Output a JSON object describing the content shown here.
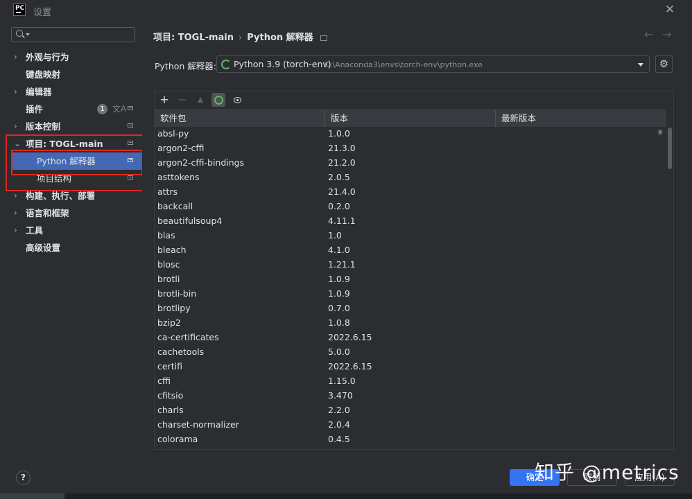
{
  "window": {
    "title": "设置",
    "logo_text": "PC"
  },
  "sidebar": {
    "search_placeholder": "",
    "items": [
      {
        "label": "外观与行为",
        "chevron": "›"
      },
      {
        "label": "键盘映射"
      },
      {
        "label": "编辑器",
        "chevron": "›"
      },
      {
        "label": "插件",
        "badge": "1",
        "translate": "文A"
      },
      {
        "label": "版本控制",
        "chevron": "›"
      },
      {
        "label": "项目: TOGL-main",
        "chevron": "⌄"
      },
      {
        "label": "Python 解释器"
      },
      {
        "label": "项目结构"
      },
      {
        "label": "构建、执行、部署",
        "chevron": "›"
      },
      {
        "label": "语言和框架",
        "chevron": "›"
      },
      {
        "label": "工具",
        "chevron": "›"
      },
      {
        "label": "高级设置"
      }
    ]
  },
  "breadcrumb": {
    "project": "项目: TOGL-main",
    "separator": "›",
    "page": "Python 解释器"
  },
  "nav": {
    "back": "←",
    "forward": "→"
  },
  "interpreter": {
    "label": "Python 解释器:",
    "name": "Python 3.9 (torch-env)",
    "path": "C:\\Anaconda3\\envs\\torch-env\\python.exe"
  },
  "toolbar": {
    "add": "+",
    "remove": "−",
    "upgrade": "▲"
  },
  "table": {
    "headers": [
      "软件包",
      "版本",
      "最新版本"
    ],
    "rows": [
      {
        "name": "absl-py",
        "version": "1.0.0",
        "latest": ""
      },
      {
        "name": "argon2-cffi",
        "version": "21.3.0",
        "latest": ""
      },
      {
        "name": "argon2-cffi-bindings",
        "version": "21.2.0",
        "latest": ""
      },
      {
        "name": "asttokens",
        "version": "2.0.5",
        "latest": ""
      },
      {
        "name": "attrs",
        "version": "21.4.0",
        "latest": ""
      },
      {
        "name": "backcall",
        "version": "0.2.0",
        "latest": ""
      },
      {
        "name": "beautifulsoup4",
        "version": "4.11.1",
        "latest": ""
      },
      {
        "name": "blas",
        "version": "1.0",
        "latest": ""
      },
      {
        "name": "bleach",
        "version": "4.1.0",
        "latest": ""
      },
      {
        "name": "blosc",
        "version": "1.21.1",
        "latest": ""
      },
      {
        "name": "brotli",
        "version": "1.0.9",
        "latest": ""
      },
      {
        "name": "brotli-bin",
        "version": "1.0.9",
        "latest": ""
      },
      {
        "name": "brotlipy",
        "version": "0.7.0",
        "latest": ""
      },
      {
        "name": "bzip2",
        "version": "1.0.8",
        "latest": ""
      },
      {
        "name": "ca-certificates",
        "version": "2022.6.15",
        "latest": ""
      },
      {
        "name": "cachetools",
        "version": "5.0.0",
        "latest": ""
      },
      {
        "name": "certifi",
        "version": "2022.6.15",
        "latest": ""
      },
      {
        "name": "cffi",
        "version": "1.15.0",
        "latest": ""
      },
      {
        "name": "cfitsio",
        "version": "3.470",
        "latest": ""
      },
      {
        "name": "charls",
        "version": "2.2.0",
        "latest": ""
      },
      {
        "name": "charset-normalizer",
        "version": "2.0.4",
        "latest": ""
      },
      {
        "name": "colorama",
        "version": "0.4.5",
        "latest": ""
      }
    ]
  },
  "footer": {
    "help": "?",
    "ok": "确定",
    "cancel": "取消",
    "apply": "应用(A)"
  },
  "watermark": "知乎 @metrics",
  "colors": {
    "accent": "#3574f0",
    "selection": "#4468b3",
    "highlight_box": "#e0281f",
    "spinner": "#5fb865"
  }
}
